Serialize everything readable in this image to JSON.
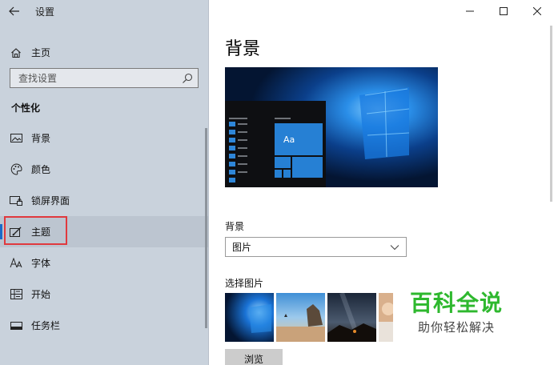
{
  "app": {
    "title": "设置",
    "back_icon": "arrow-left-icon"
  },
  "window_controls": {
    "minimize": "—",
    "maximize": "☐",
    "close": "✕"
  },
  "sidebar": {
    "home_label": "主页",
    "search_placeholder": "查找设置",
    "section_header": "个性化",
    "items": [
      {
        "label": "背景",
        "icon": "picture-icon",
        "selected": false
      },
      {
        "label": "颜色",
        "icon": "palette-icon",
        "selected": false
      },
      {
        "label": "锁屏界面",
        "icon": "lock-screen-icon",
        "selected": false
      },
      {
        "label": "主题",
        "icon": "theme-icon",
        "selected": true
      },
      {
        "label": "字体",
        "icon": "font-icon",
        "selected": false
      },
      {
        "label": "开始",
        "icon": "start-icon",
        "selected": false
      },
      {
        "label": "任务栏",
        "icon": "taskbar-icon",
        "selected": false
      }
    ]
  },
  "main": {
    "page_title": "背景",
    "preview_tile_label": "Aa",
    "background_label": "背景",
    "background_value": "图片",
    "choose_picture_label": "选择图片",
    "browse_label": "浏览"
  },
  "watermark": {
    "title": "百科全说",
    "subtitle": "助你轻松解决"
  },
  "colors": {
    "accent": "#1b6ac9",
    "sidebar_bg": "#c9d2dc",
    "highlight": "#e0393e",
    "watermark_green": "#2eb82e"
  }
}
